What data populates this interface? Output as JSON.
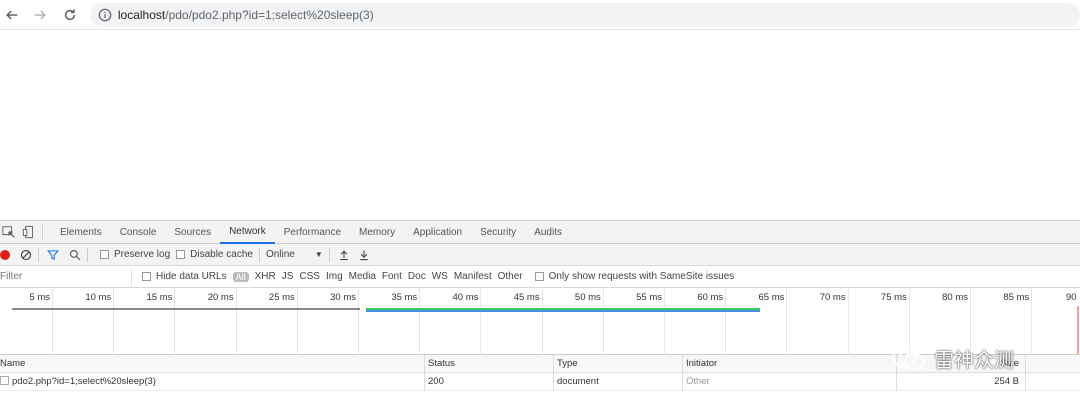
{
  "browser": {
    "url_host": "localhost",
    "url_path": "/pdo/pdo2.php?id=1;select%20sleep(3)"
  },
  "devtools": {
    "tabs": [
      "Elements",
      "Console",
      "Sources",
      "Network",
      "Performance",
      "Memory",
      "Application",
      "Security",
      "Audits"
    ],
    "active_tab": "Network",
    "toolbar": {
      "preserve_log": "Preserve log",
      "disable_cache": "Disable cache",
      "throttle": "Online"
    },
    "filter": {
      "placeholder": "Filter",
      "hide_data_urls": "Hide data URLs",
      "all": "All",
      "types": [
        "XHR",
        "JS",
        "CSS",
        "Img",
        "Media",
        "Font",
        "Doc",
        "WS",
        "Manifest",
        "Other"
      ],
      "samesite": "Only show requests with SameSite issues"
    },
    "timeline": {
      "ticks": [
        "5 ms",
        "10 ms",
        "15 ms",
        "20 ms",
        "25 ms",
        "30 ms",
        "35 ms",
        "40 ms",
        "45 ms",
        "50 ms",
        "55 ms",
        "60 ms",
        "65 ms",
        "70 ms",
        "75 ms",
        "80 ms",
        "85 ms",
        "90"
      ],
      "line_colors": {
        "gray": "#8a8a8a",
        "green": "#3cc96a",
        "blue": "#4a90e2"
      }
    },
    "grid": {
      "headers": {
        "name": "Name",
        "status": "Status",
        "type": "Type",
        "initiator": "Initiator",
        "size": "Size"
      },
      "rows": [
        {
          "name": "pdo2.php?id=1;select%20sleep(3)",
          "status": "200",
          "type": "document",
          "initiator": "Other",
          "size": "254 B"
        }
      ]
    }
  },
  "watermark": "雷神众测"
}
